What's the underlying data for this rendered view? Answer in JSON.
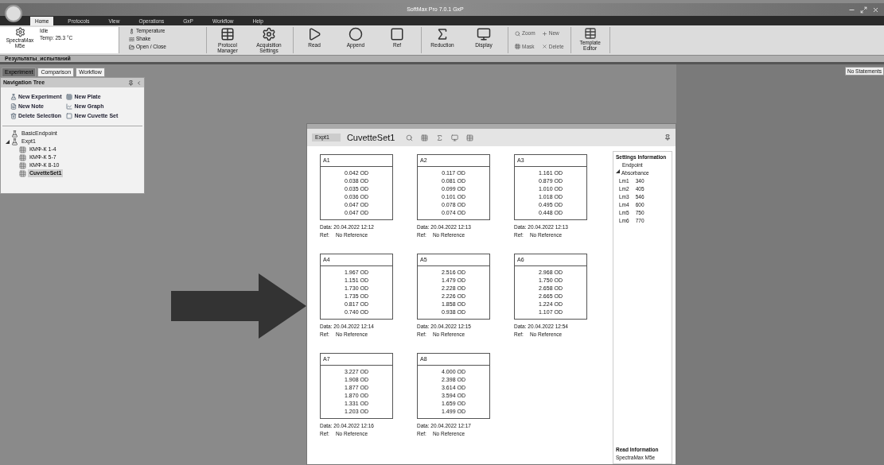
{
  "window": {
    "title": "SoftMax Pro 7.0.1 GxP"
  },
  "menu_tabs": [
    {
      "label": "Home",
      "selected": true
    },
    {
      "label": "Protocols",
      "selected": false
    },
    {
      "label": "View",
      "selected": false
    },
    {
      "label": "Operations",
      "selected": false
    },
    {
      "label": "GxP",
      "selected": false
    },
    {
      "label": "Workflow",
      "selected": false
    },
    {
      "label": "Help",
      "selected": false
    }
  ],
  "ribbon": {
    "instrument": "SpectraMax M5e",
    "status": "Idle",
    "temperature": "Temp: 25.3 °C",
    "small_buttons": [
      "Temperature",
      "Shake",
      "Open / Close"
    ],
    "large_buttons": [
      {
        "label": "Protocol Manager",
        "kind": "manager"
      },
      {
        "label": "Acquisition Settings",
        "kind": "settings"
      },
      {
        "label": "Read",
        "kind": "read"
      },
      {
        "label": "Append",
        "kind": "append"
      },
      {
        "label": "Ref",
        "kind": "ref"
      },
      {
        "label": "Reduction",
        "kind": "sigma"
      },
      {
        "label": "Display",
        "kind": "display"
      }
    ],
    "graph_buttons": [
      "Zoom",
      "New",
      "Mask",
      "Delete"
    ],
    "template": "Template Editor"
  },
  "experiment": {
    "title": "Результаты_испытаний"
  },
  "no_statements": "No Statements",
  "panel_tabs": [
    {
      "label": "Experiment",
      "selected": true
    },
    {
      "label": "Comparison",
      "selected": false
    },
    {
      "label": "Workflow",
      "selected": false
    }
  ],
  "navigation_tree": {
    "title": "Navigation Tree",
    "actions": [
      "New Experiment",
      "New Plate",
      "New Note",
      "New Graph",
      "Delete Selection",
      "New Cuvette Set"
    ],
    "items": [
      {
        "label": "BasicEndpoint",
        "selected": false
      },
      {
        "label": "Expt1",
        "selected": false,
        "expanded": true,
        "children": [
          {
            "label": "КМФ-К 1-4",
            "selected": false
          },
          {
            "label": "КМФ-К 5-7",
            "selected": false
          },
          {
            "label": "КМФ-К 8-10",
            "selected": false
          },
          {
            "label": "CuvetteSet1",
            "selected": true
          }
        ]
      }
    ]
  },
  "document": {
    "breadcrumb": "Expt1",
    "title": "CuvetteSet1",
    "cuvettes": [
      {
        "name": "A1",
        "values": [
          "0.042 OD",
          "0.038 OD",
          "0.035 OD",
          "0.036 OD",
          "0.047 OD",
          "0.047 OD"
        ],
        "date": "Data: 20.04.2022 12:12",
        "ref": "Ref:",
        "ref_value": "No Reference"
      },
      {
        "name": "A2",
        "values": [
          "0.117 OD",
          "0.081 OD",
          "0.099 OD",
          "0.101 OD",
          "0.078 OD",
          "0.074 OD"
        ],
        "date": "Data: 20.04.2022 12:13",
        "ref": "Ref:",
        "ref_value": "No Reference"
      },
      {
        "name": "A3",
        "values": [
          "1.161 OD",
          "0.879 OD",
          "1.010 OD",
          "1.018 OD",
          "0.495 OD",
          "0.448 OD"
        ],
        "date": "Data: 20.04.2022 12:13",
        "ref": "Ref:",
        "ref_value": "No Reference"
      },
      {
        "name": "A4",
        "values": [
          "1.967 OD",
          "1.151 OD",
          "1.730 OD",
          "1.735 OD",
          "0.817 OD",
          "0.740 OD"
        ],
        "date": "Data: 20.04.2022 12:14",
        "ref": "Ref:",
        "ref_value": "No Reference"
      },
      {
        "name": "A5",
        "values": [
          "2.516 OD",
          "1.479 OD",
          "2.228 OD",
          "2.226 OD",
          "1.858 OD",
          "0.938 OD"
        ],
        "date": "Data: 20.04.2022 12:15",
        "ref": "Ref:",
        "ref_value": "No Reference"
      },
      {
        "name": "A6",
        "values": [
          "2.968 OD",
          "1.750 OD",
          "2.658 OD",
          "2.665 OD",
          "1.224 OD",
          "1.107 OD"
        ],
        "date": "Data: 20.04.2022 12:54",
        "ref": "Ref:",
        "ref_value": "No Reference"
      },
      {
        "name": "A7",
        "values": [
          "3.227 OD",
          "1.908 OD",
          "1.877 OD",
          "1.870 OD",
          "1.331 OD",
          "1.203 OD"
        ],
        "date": "Data: 20.04.2022 12:16",
        "ref": "Ref:",
        "ref_value": "No Reference"
      },
      {
        "name": "A8",
        "values": [
          "4.000 OD",
          "2.398 OD",
          "3.614 OD",
          "3.594 OD",
          "1.659 OD",
          "1.499 OD"
        ],
        "date": "Data: 20.04.2022 12:17",
        "ref": "Ref:",
        "ref_value": "No Reference"
      }
    ],
    "settings": {
      "title": "Settings Information",
      "mode": "Endpoint",
      "group": "Absorbance",
      "group_expanded": true,
      "wavelengths": [
        {
          "label": "Lm1",
          "value": "340"
        },
        {
          "label": "Lm2",
          "value": "405"
        },
        {
          "label": "Lm3",
          "value": "546"
        },
        {
          "label": "Lm4",
          "value": "600"
        },
        {
          "label": "Lm5",
          "value": "750"
        },
        {
          "label": "Lm6",
          "value": "770"
        }
      ],
      "read_title": "Read Information",
      "read_value": "SpectraMax M5e"
    }
  }
}
